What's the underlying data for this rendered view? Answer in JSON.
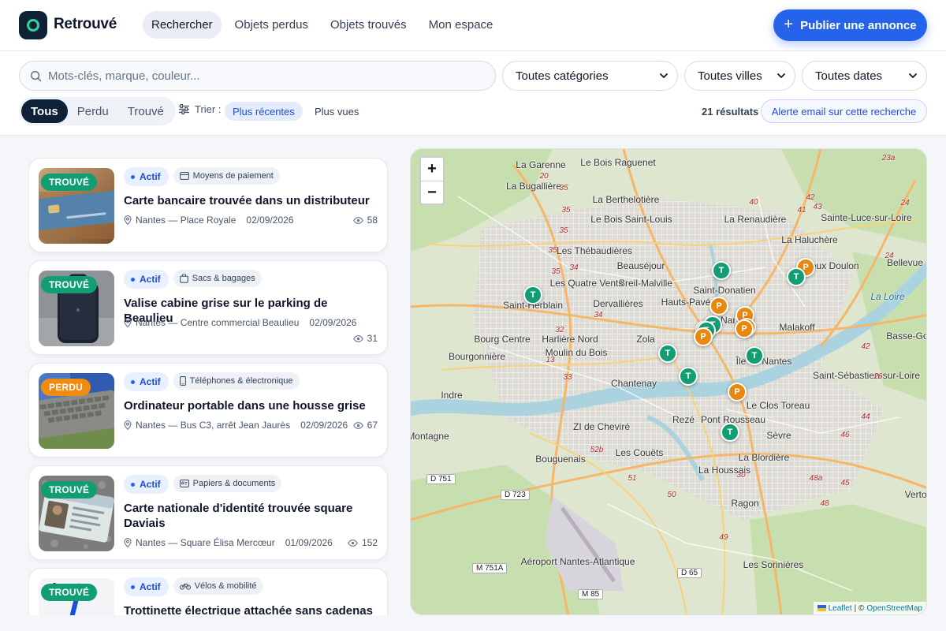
{
  "app": {
    "brand": "Retrouvé"
  },
  "nav": [
    {
      "label": "Rechercher",
      "active": true
    },
    {
      "label": "Objets perdus",
      "active": false
    },
    {
      "label": "Objets trouvés",
      "active": false
    },
    {
      "label": "Mon espace",
      "active": false
    }
  ],
  "publish": {
    "label": "Publier une annonce"
  },
  "filters": {
    "search_placeholder": "Mots-clés, marque, couleur...",
    "search_value": "",
    "category": "Toutes catégories",
    "city": "Toutes villes",
    "date": "Toutes dates",
    "segments": [
      {
        "label": "Tous",
        "active": true
      },
      {
        "label": "Perdu",
        "active": false
      },
      {
        "label": "Trouvé",
        "active": false
      }
    ],
    "sort_label": "Trier :",
    "sort_options": [
      {
        "label": "Plus récentes",
        "active": true
      },
      {
        "label": "Plus vues",
        "active": false
      }
    ],
    "results": "21 résultats",
    "alert_label": "Alerte email sur cette recherche"
  },
  "listings": [
    {
      "type": "TROUVÉ",
      "status": "Actif",
      "category": "Moyens de paiement",
      "title": "Carte bancaire trouvée dans un distributeur",
      "location": "Nantes — Place Royale",
      "date": "02/09/2026",
      "views": "58"
    },
    {
      "type": "TROUVÉ",
      "status": "Actif",
      "category": "Sacs & bagages",
      "title": "Valise cabine grise sur le parking de Beaulieu",
      "location": "Nantes — Centre commercial Beaulieu",
      "date": "02/09/2026",
      "views": "31"
    },
    {
      "type": "PERDU",
      "status": "Actif",
      "category": "Téléphones & électronique",
      "title": "Ordinateur portable dans une housse grise",
      "location": "Nantes — Bus C3, arrêt Jean Jaurès",
      "date": "02/09/2026",
      "views": "67"
    },
    {
      "type": "TROUVÉ",
      "status": "Actif",
      "category": "Papiers & documents",
      "title": "Carte nationale d'identité trouvée square Daviais",
      "location": "Nantes — Square Élisa Mercœur",
      "date": "01/09/2026",
      "views": "152"
    },
    {
      "type": "TROUVÉ",
      "status": "Actif",
      "category": "Vélos & mobilité",
      "title": "Trottinette électrique attachée sans cadenas",
      "location": "",
      "date": "",
      "views": ""
    }
  ],
  "map": {
    "zoom_in": "+",
    "zoom_out": "−",
    "place_labels": [
      "Le Bois Raguenet",
      "La Garenne",
      "La Bugallière",
      "La Berthelotière",
      "Le Bois Saint-Louis",
      "La Renaudière",
      "Sainte-Luce-sur-Loire",
      "La Haluchère",
      "Les Thébaudières",
      "Beauséjour",
      "Breil-Malville",
      "Vieux Doulon",
      "Bellevue",
      "Saint-Herblain",
      "Les Quatre Vents",
      "Dervallières",
      "Hauts-Pavés",
      "Saint-Donatien",
      "Nantes",
      "Malakoff",
      "Bourg Centre",
      "Harlière Nord",
      "Zola",
      "Moulin du Bois",
      "Île de Nantes",
      "Bourgonnière",
      "Chantenay",
      "Saint-Sébastien-sur-Loire",
      "Basse-Goulaine",
      "Indre",
      "Le Clos Toreau",
      "Rezé",
      "Pont Rousseau",
      "ZI de Cheviré",
      "Montagne",
      "Sèvre",
      "Bouguenais",
      "Les Couëts",
      "La Blordière",
      "La Houssais",
      "Vertou",
      "Ragon",
      "Aéroport Nantes-Atlantique",
      "Les Sorinières",
      "La Loire"
    ],
    "road_badges": [
      "D 751",
      "D 723",
      "M 751A",
      "D 65",
      "M 85"
    ],
    "attribution_leaflet": "Leaflet",
    "attribution_sep": "| ©",
    "attribution_osm": "OpenStreetMap",
    "markers": [
      {
        "kind": "T"
      },
      {
        "kind": "T"
      },
      {
        "kind": "P"
      },
      {
        "kind": "T"
      },
      {
        "kind": "P"
      },
      {
        "kind": "P"
      },
      {
        "kind": "T"
      },
      {
        "kind": "T"
      },
      {
        "kind": "P"
      },
      {
        "kind": "P"
      },
      {
        "kind": "T"
      },
      {
        "kind": "P"
      },
      {
        "kind": "T"
      },
      {
        "kind": "T"
      },
      {
        "kind": "P"
      },
      {
        "kind": "T"
      },
      {
        "kind": "P"
      },
      {
        "kind": "T"
      }
    ]
  }
}
